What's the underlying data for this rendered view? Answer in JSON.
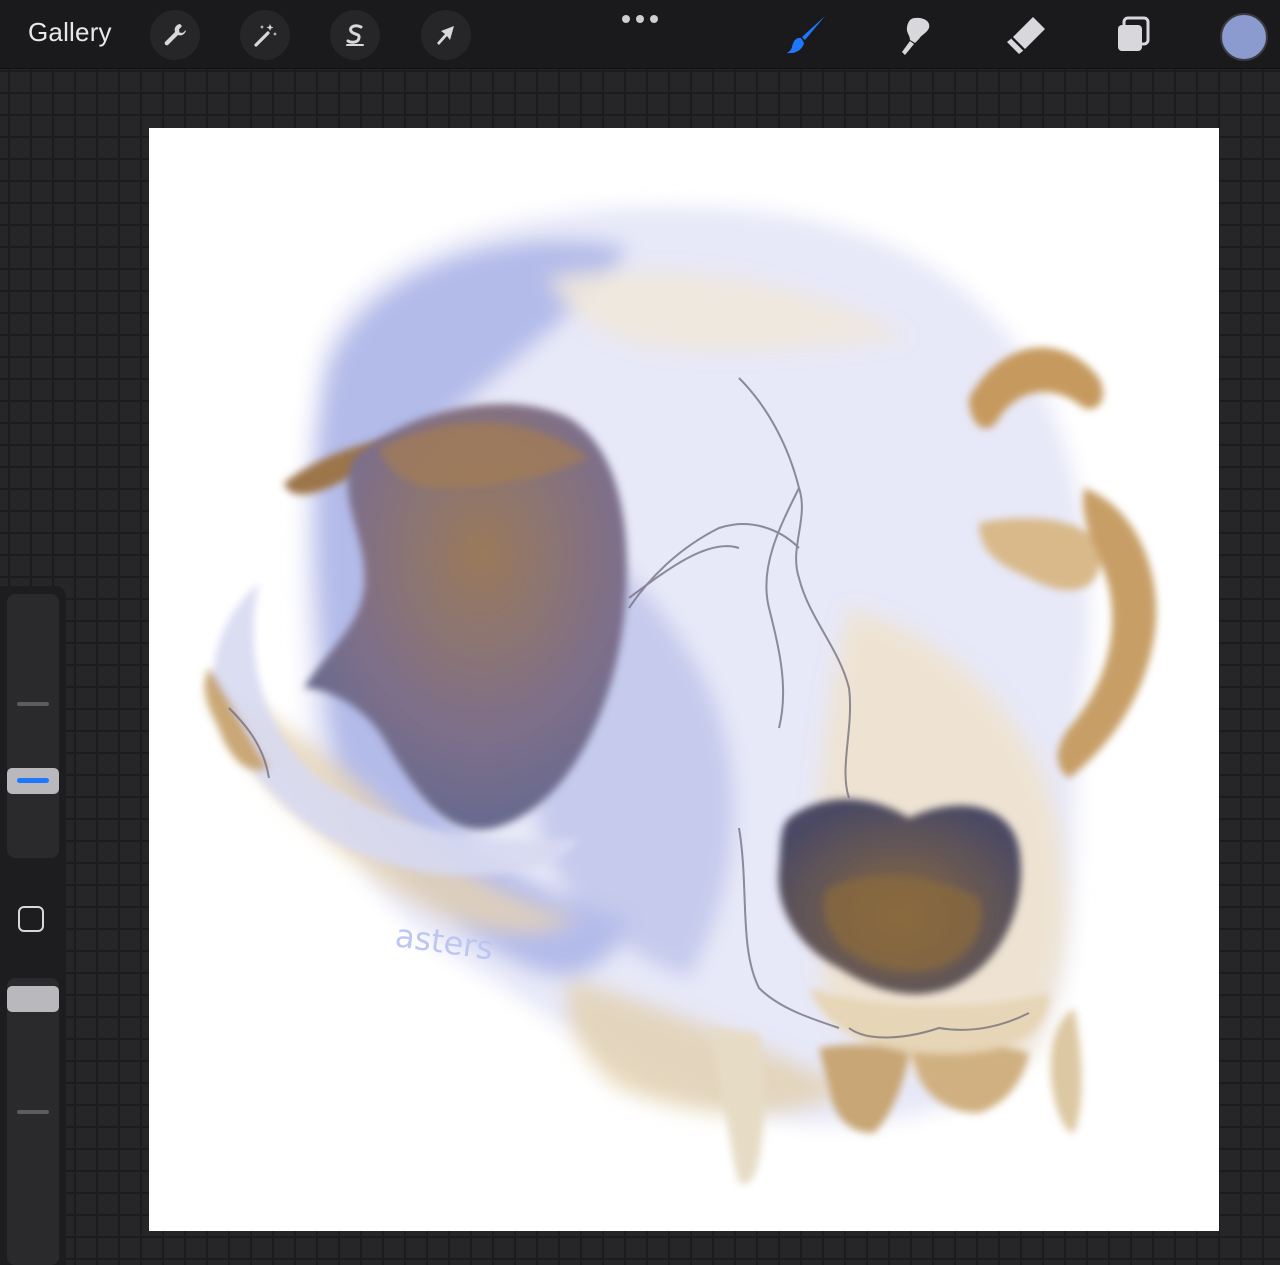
{
  "toolbar": {
    "gallery_label": "Gallery",
    "left_tools": [
      {
        "name": "actions",
        "icon": "wrench-icon"
      },
      {
        "name": "adjustments",
        "icon": "magic-wand-icon"
      },
      {
        "name": "selection",
        "icon": "selection-s-icon"
      },
      {
        "name": "transform",
        "icon": "arrow-cursor-icon"
      }
    ],
    "more_icon": "more-dots-icon",
    "right_tools": [
      {
        "name": "brush",
        "icon": "brush-icon",
        "active": true
      },
      {
        "name": "smudge",
        "icon": "smudge-icon",
        "active": false
      },
      {
        "name": "eraser",
        "icon": "eraser-icon",
        "active": false
      },
      {
        "name": "layers",
        "icon": "layers-icon",
        "active": false
      }
    ],
    "current_color": "#8b9acf",
    "accent_color": "#1e78ff"
  },
  "sidebar": {
    "brush_size_handle_color": "#1e78ff",
    "opacity_handle_color": "#b9b9bd",
    "modify_icon": "square-outline-icon"
  },
  "canvas": {
    "artwork_subject": "cat-skull-painting",
    "signature": "asters"
  }
}
